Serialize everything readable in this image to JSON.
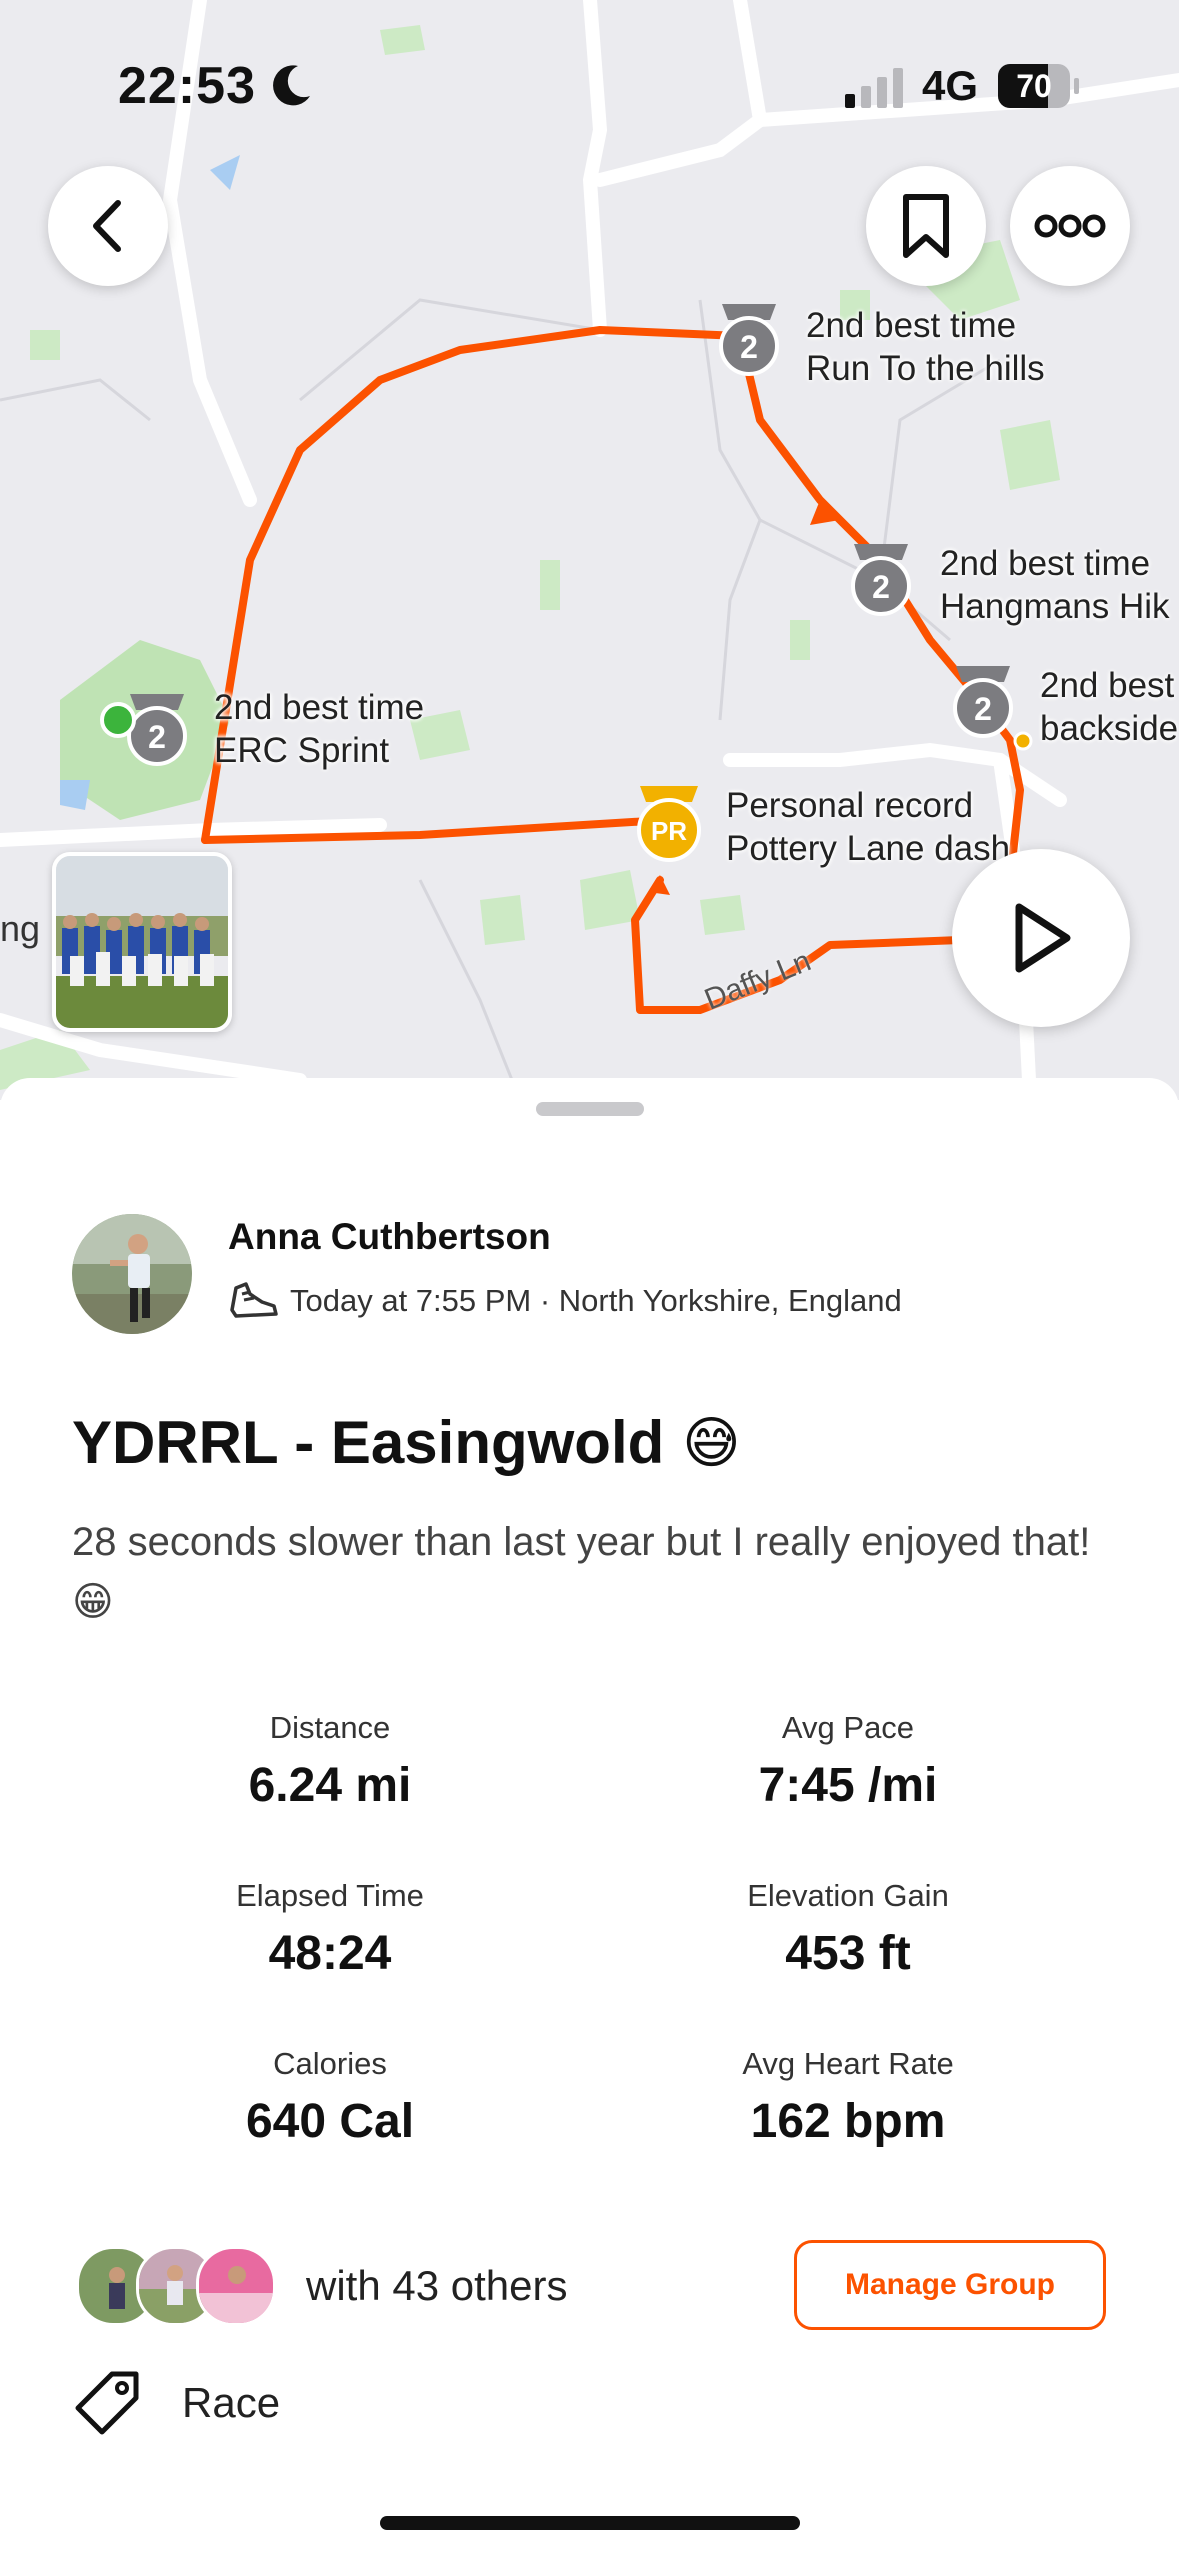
{
  "status_bar": {
    "time": "22:53",
    "network": "4G",
    "battery": "70",
    "battery_level": 0.7
  },
  "map": {
    "street_labels": [
      "Daffy Ln"
    ],
    "edge_label": "ng",
    "segments": [
      {
        "line1": "2nd best time",
        "line2": "Run To the hills",
        "badge": "2"
      },
      {
        "line1": "2nd best time",
        "line2": "Hangmans Hik",
        "badge": "2"
      },
      {
        "line1": "2nd best",
        "line2": "backside",
        "badge": "2"
      },
      {
        "line1": "2nd best time",
        "line2": "ERC Sprint",
        "badge": "2"
      },
      {
        "line1": "Personal record",
        "line2": "Pottery Lane dash",
        "badge": "PR"
      }
    ],
    "route_color": "#fc5200",
    "pr_color": "#f2b100"
  },
  "activity": {
    "athlete_name": "Anna Cuthbertson",
    "meta": "Today at 7:55 PM · North Yorkshire, England",
    "title": "YDRRL - Easingwold",
    "title_emoji": "😅",
    "description": "28 seconds slower than last year but I really enjoyed that! 😁",
    "stats": [
      {
        "label": "Distance",
        "value": "6.24 mi"
      },
      {
        "label": "Avg Pace",
        "value": "7:45 /mi"
      },
      {
        "label": "Elapsed Time",
        "value": "48:24"
      },
      {
        "label": "Elevation Gain",
        "value": "453 ft"
      },
      {
        "label": "Calories",
        "value": "640 Cal"
      },
      {
        "label": "Avg Heart Rate",
        "value": "162 bpm"
      }
    ],
    "group_text": "with 43 others",
    "manage_group": "Manage Group",
    "tag": "Race"
  }
}
